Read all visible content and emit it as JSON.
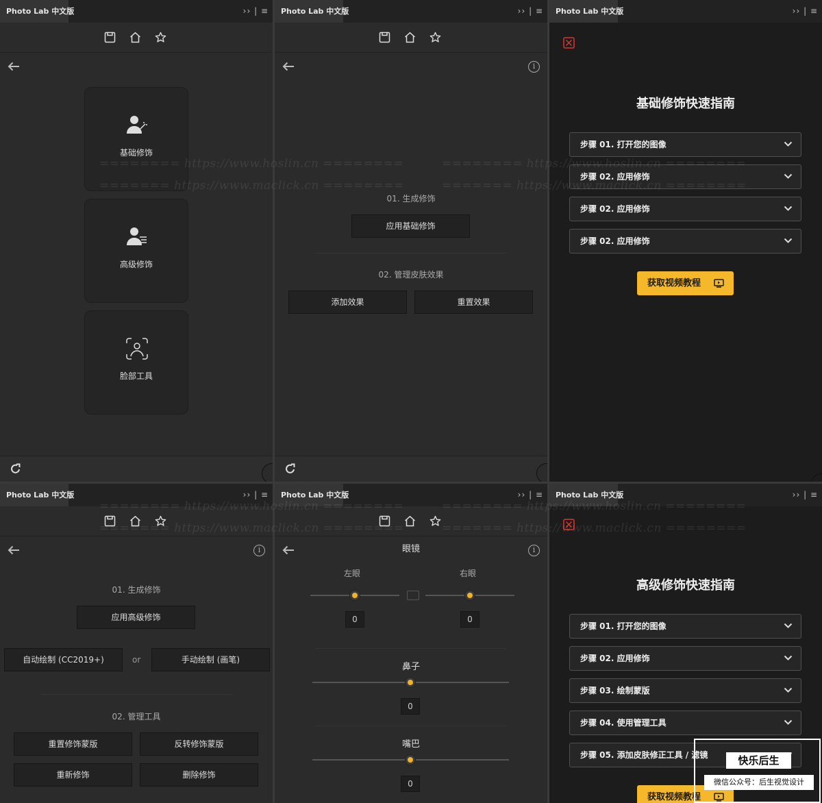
{
  "app": {
    "tab_title": "Photo Lab 中文版",
    "tab_controls": "›› | ≡",
    "icons": [
      "save-icon",
      "home-icon",
      "star-icon"
    ]
  },
  "home_menu": {
    "cards": [
      {
        "label": "基础修饰",
        "icon": "basic-retouch-icon"
      },
      {
        "label": "高级修饰",
        "icon": "advanced-retouch-icon"
      },
      {
        "label": "脸部工具",
        "icon": "face-tools-icon"
      }
    ]
  },
  "basic_panel": {
    "section1": "01. 生成修饰",
    "apply_basic": "应用基础修饰",
    "section2": "02. 管理皮肤效果",
    "add_effect": "添加效果",
    "reset_effect": "重置效果"
  },
  "basic_guide": {
    "title": "基础修饰快速指南",
    "steps": [
      "步骤 01. 打开您的图像",
      "步骤 02. 应用修饰",
      "步骤 02. 应用修饰",
      "步骤 02. 应用修饰"
    ],
    "video_button": "获取视频教程"
  },
  "advanced_panel": {
    "section1": "01. 生成修饰",
    "apply_advanced": "应用高级修饰",
    "auto_draw": "自动绘制 (CC2019+)",
    "or": "or",
    "manual_draw": "手动绘制 (画笔)",
    "section2": "02. 管理工具",
    "reset_mask": "重置修饰蒙版",
    "invert_mask": "反转修饰蒙版",
    "re_retouch": "重新修饰",
    "delete_retouch": "删除修饰"
  },
  "face_panel": {
    "glasses": "眼镜",
    "left_eye": "左眼",
    "right_eye": "右眼",
    "left_value": "0",
    "right_value": "0",
    "nose": "鼻子",
    "nose_value": "0",
    "mouth": "嘴巴",
    "mouth_value": "0"
  },
  "advanced_guide": {
    "title": "高级修饰快速指南",
    "steps": [
      "步骤 01. 打开您的图像",
      "步骤 02. 应用修饰",
      "步骤 03. 绘制蒙版",
      "步骤 04. 使用管理工具",
      "步骤 05. 添加皮肤修正工具 / 滤镜"
    ],
    "video_button": "获取视频教程"
  },
  "watermarks": {
    "hoslin": "======== https://www.hoslin.cn ========",
    "maclick": "======= https://www.maclick.cn ========"
  },
  "wechat": {
    "name": "快乐后生",
    "subtitle": "微信公众号：后生视觉设计"
  },
  "colors": {
    "accent": "#f6b82b",
    "panel_bg": "#2b2b2b",
    "guide_bg": "#1c1c1c",
    "close_red": "#e0342c"
  }
}
